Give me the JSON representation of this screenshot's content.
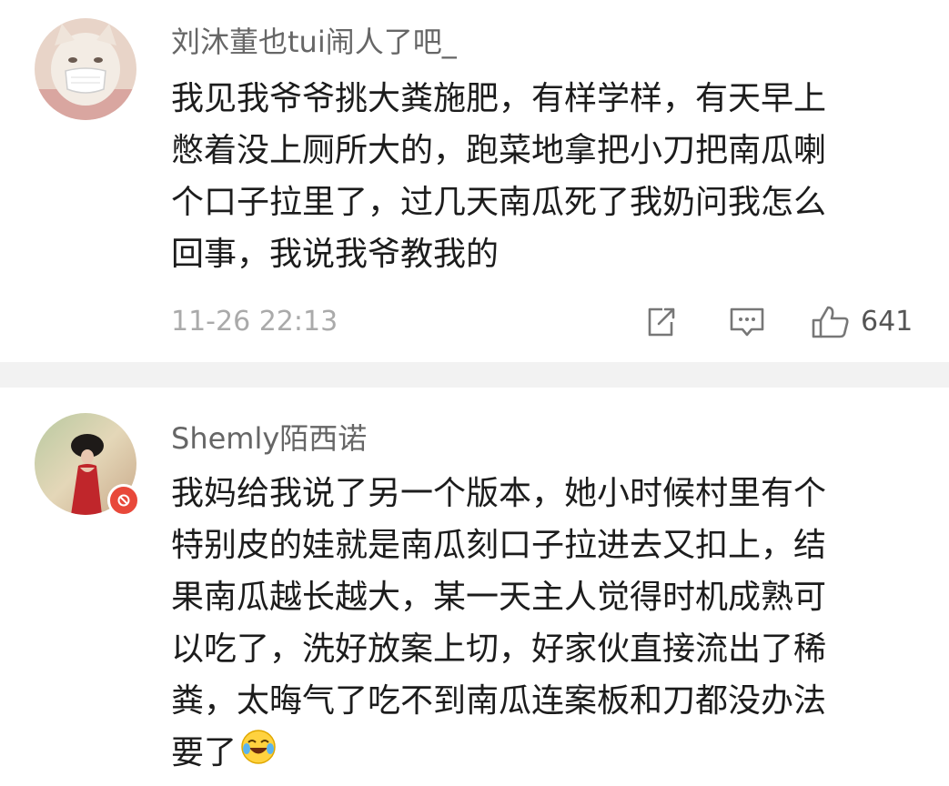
{
  "comments": [
    {
      "username": "刘沐董也tui闹人了吧_",
      "body_lines": [
        "我见我爷爷挑大粪施肥，有样学样，有天早上",
        "憋着没上厕所大的，跑菜地拿把小刀把南瓜喇",
        "个口子拉里了，过几天南瓜死了我奶问我怎么",
        "回事，我说我爷教我的"
      ],
      "timestamp": "11-26 22:13",
      "like_count": "641",
      "icons": {
        "share": "share-icon",
        "reply": "comment-icon",
        "like": "thumbs-up-icon"
      },
      "avatar": "cat-with-mask-avatar"
    },
    {
      "username": "Shemly陌西诺",
      "body_lines": [
        "我妈给我说了另一个版本，她小时候村里有个",
        "特别皮的娃就是南瓜刻口子拉进去又扣上，结",
        "果南瓜越长越大，某一天主人觉得时机成熟可",
        "以吃了，洗好放案上切，好家伙直接流出了稀",
        "粪，太晦气了吃不到南瓜连案板和刀都没办法",
        "要了"
      ],
      "emoji": "laughing-crying-emoji",
      "avatar": "woman-red-dress-avatar",
      "badge": "verified-badge"
    }
  ],
  "colors": {
    "username": "#666666",
    "body": "#1c1c1c",
    "timestamp": "#aaaaaa",
    "divider": "#f2f2f2",
    "badge": "#e8483a"
  }
}
